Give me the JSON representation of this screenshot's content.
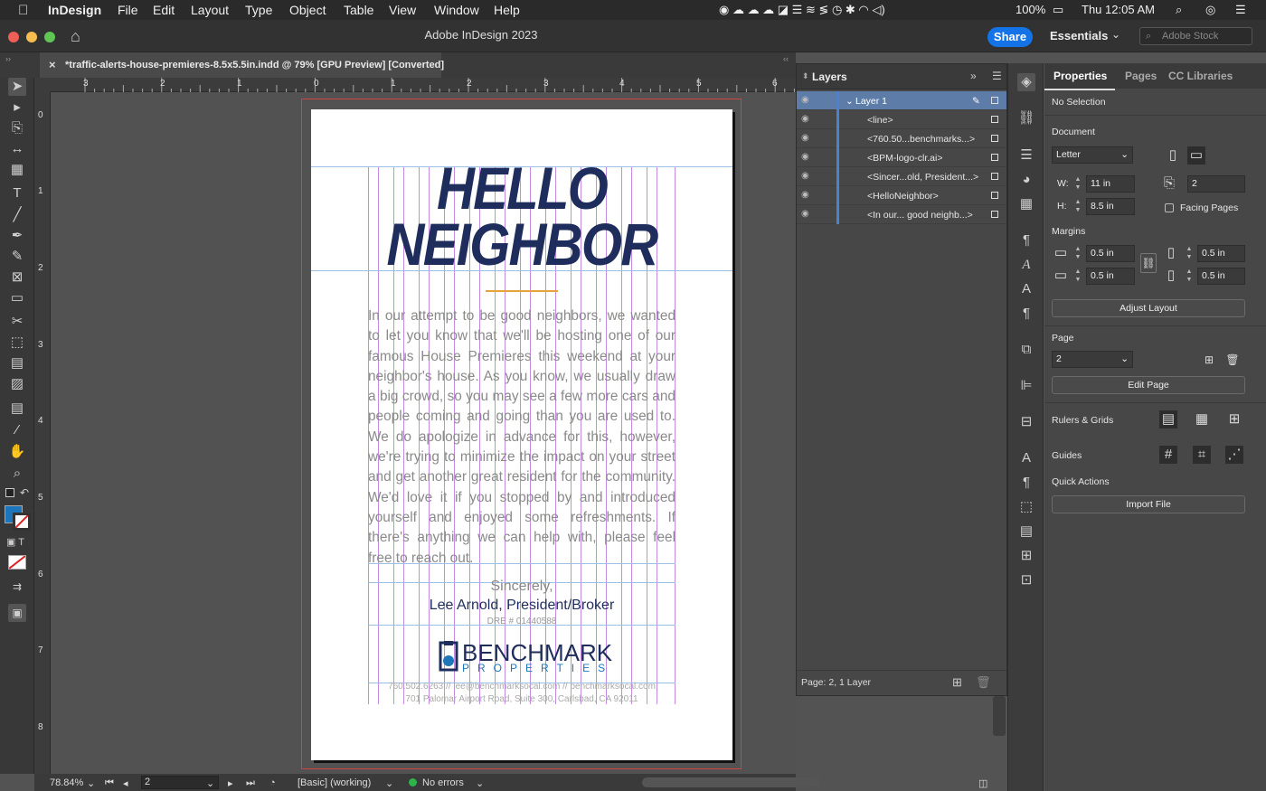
{
  "menubar": {
    "apple": "",
    "app": "InDesign",
    "items": [
      "File",
      "Edit",
      "Layout",
      "Type",
      "Object",
      "Table",
      "View",
      "Window",
      "Help"
    ],
    "battery": "100%",
    "clock": "Thu 12:05 AM"
  },
  "titlebar": {
    "title": "Adobe InDesign 2023",
    "share": "Share",
    "workspace": "Essentials",
    "stock_placeholder": "Adobe Stock"
  },
  "doc_tab": {
    "close": "×",
    "title": "*traffic-alerts-house-premieres-8.5x5.5in.indd @ 79% [GPU Preview] [Converted]"
  },
  "ruler": {
    "h_labels": [
      "3",
      "2",
      "1",
      "0",
      "1",
      "2",
      "3",
      "4",
      "5",
      "6"
    ],
    "v_labels": [
      "0",
      "1",
      "2",
      "3",
      "4",
      "5",
      "6",
      "7",
      "8"
    ]
  },
  "document": {
    "headline1": "HELLO",
    "headline2": "NEIGHBOR",
    "body": "In our attempt to be good neighbors, we wanted to let you know that we'll be hosting one of our famous House Premieres this weekend at your neighbor's house. As you know, we usually draw a big crowd, so you may see a few more cars and people coming and going than you are used to. We do apologize in advance for this, however, we're trying to minimize the impact on your street and get another great resident for the community. We'd love it if you stopped by and introduced yourself and enjoyed some refreshments. If there's anything we can help with, please feel free to reach out.",
    "closing": "Sincerely,",
    "signer": "Lee Arnold, President/Broker",
    "dre": "DRE # 01440588",
    "logo_name": "BENCHMARK",
    "logo_sub": "PROPERTIES",
    "contact_line1": "760.502.6263  //  lee@benchmarksocal.com  //  benchmarksocal.com",
    "contact_line2": "701 Palomar Airport Road, Suite 300, Carlsbad, CA 92011",
    "colors": {
      "navy": "#1e2d5c",
      "accent": "#e7a23b",
      "logo_blue": "#1d75bc"
    }
  },
  "statusbar": {
    "zoom": "78.84%",
    "page": "2",
    "style": "[Basic] (working)",
    "preflight": "No errors"
  },
  "layers_panel": {
    "title": "Layers",
    "layer": "Layer 1",
    "items": [
      "<line>",
      "<760.50...benchmarks...>",
      "<BPM-logo-clr.ai>",
      "<Sincer...old, President...>",
      "<HelloNeighbor>",
      "<In our... good neighb...>"
    ],
    "footer": "Page: 2, 1 Layer"
  },
  "properties": {
    "tabs": [
      "Properties",
      "Pages",
      "CC Libraries"
    ],
    "selection": "No Selection",
    "document_label": "Document",
    "preset": "Letter",
    "w_label": "W:",
    "w": "11 in",
    "h_label": "H:",
    "h": "8.5 in",
    "pages": "2",
    "facing": "Facing Pages",
    "margins_label": "Margins",
    "margin_top": "0.5 in",
    "margin_bottom": "0.5 in",
    "margin_left": "0.5 in",
    "margin_right": "0.5 in",
    "adjust_layout": "Adjust Layout",
    "page_label": "Page",
    "page_value": "2",
    "edit_page": "Edit Page",
    "rulers_grids": "Rulers & Grids",
    "guides": "Guides",
    "quick_actions": "Quick Actions",
    "import_file": "Import File"
  }
}
